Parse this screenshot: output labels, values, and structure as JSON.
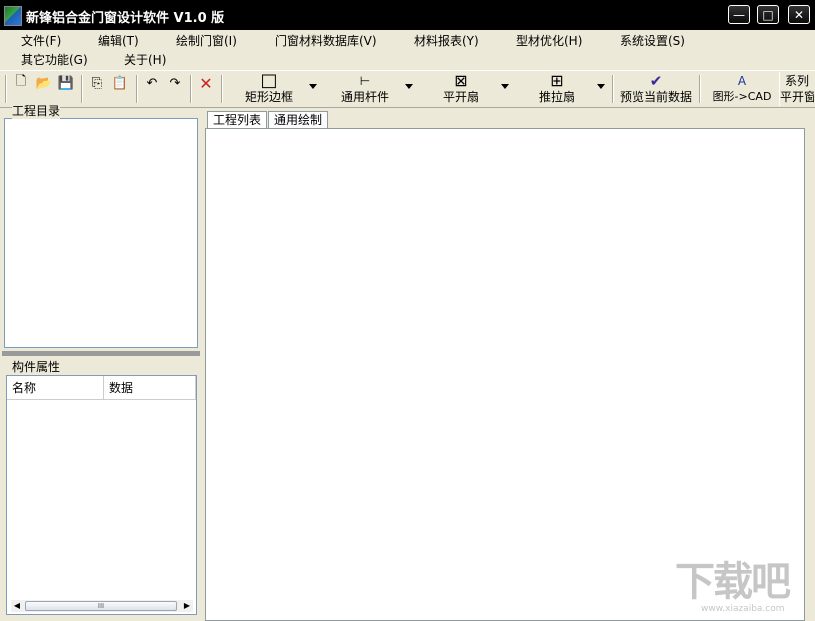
{
  "window": {
    "title": "新锋铝合金门窗设计软件 V1.0 版",
    "controls": {
      "minimize": "—",
      "maximize": "□",
      "close": "✕"
    }
  },
  "menu": {
    "items": [
      "文件(F)",
      "编辑(T)",
      "绘制门窗(I)",
      "门窗材料数据库(V)",
      "材料报表(Y)",
      "型材优化(H)",
      "系统设置(S)",
      "其它功能(G)",
      "关于(H)"
    ]
  },
  "toolbar": {
    "small": {
      "new": "🗋",
      "open": "📂",
      "save": "💾",
      "copy": "⎘",
      "paste": "📋",
      "undo": "↶",
      "redo": "↷",
      "delete": "✕"
    },
    "big": [
      {
        "icon": "□",
        "label": "矩形边框"
      },
      {
        "icon": "⊢",
        "label": "通用杆件"
      },
      {
        "icon": "⊠",
        "label": "平开扇"
      },
      {
        "icon": "⊞",
        "label": "推拉扇"
      },
      {
        "icon": "✔",
        "label": "预览当前数据"
      },
      {
        "icon": "A",
        "label": "图形->CAD"
      },
      {
        "icon": "系列",
        "label": "平开窗"
      }
    ],
    "accent": {
      "check": "#3a2a9a",
      "delete": "#cc2222"
    }
  },
  "left_panel": {
    "project_title": "工程目录",
    "properties_title": "构件属性",
    "columns": [
      "名称",
      "数据"
    ],
    "scroll": {
      "left": "◀",
      "right": "▶",
      "grip": "III"
    }
  },
  "tabs": [
    "工程列表",
    "通用绘制"
  ],
  "watermark": {
    "big": "下载吧",
    "small": "www.xiazaiba.com"
  }
}
